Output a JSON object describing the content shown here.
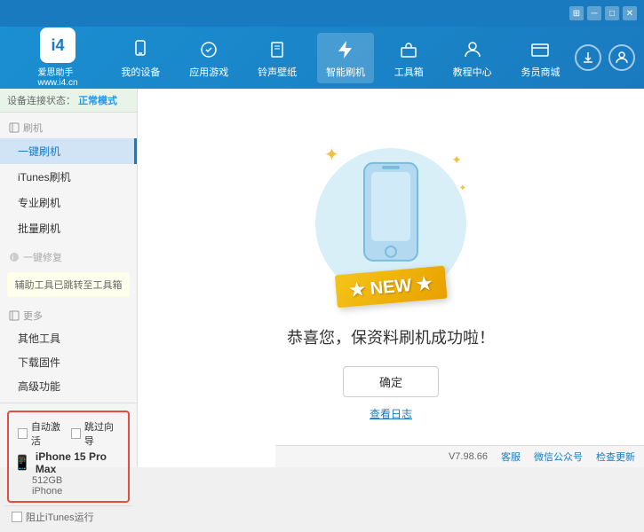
{
  "topbar": {
    "icons": [
      "grid-icon",
      "minus-icon",
      "restore-icon",
      "close-icon"
    ]
  },
  "header": {
    "logo": {
      "text": "爱思助手",
      "subtext": "www.i4.cn"
    },
    "nav": [
      {
        "id": "my-device",
        "label": "我的设备",
        "icon": "device"
      },
      {
        "id": "apps-games",
        "label": "应用游戏",
        "icon": "apps"
      },
      {
        "id": "ringtones",
        "label": "铃声壁纸",
        "icon": "ringtone"
      },
      {
        "id": "smart-flash",
        "label": "智能刷机",
        "icon": "flash",
        "active": true
      },
      {
        "id": "toolbox",
        "label": "工具箱",
        "icon": "toolbox"
      },
      {
        "id": "tutorial",
        "label": "教程中心",
        "icon": "tutorial"
      },
      {
        "id": "service",
        "label": "务员商城",
        "icon": "service"
      }
    ],
    "right": {
      "download_icon": "download",
      "user_icon": "user"
    }
  },
  "status": {
    "label": "设备连接状态：",
    "value": "正常模式"
  },
  "sidebar": {
    "flash_group": {
      "label": "刷机",
      "items": [
        {
          "id": "one-click-flash",
          "label": "一键刷机",
          "active": true
        },
        {
          "id": "itunes-flash",
          "label": "iTunes刷机"
        },
        {
          "id": "pro-flash",
          "label": "专业刷机"
        },
        {
          "id": "batch-flash",
          "label": "批量刷机"
        }
      ]
    },
    "one_click_restore": {
      "label": "一键修复",
      "disabled": true
    },
    "warning_text": "辅助工具已跳转至工具箱",
    "more_group": {
      "label": "更多",
      "items": [
        {
          "id": "other-tools",
          "label": "其他工具"
        },
        {
          "id": "download-firmware",
          "label": "下载固件"
        },
        {
          "id": "advanced",
          "label": "高级功能"
        }
      ]
    }
  },
  "bottom_controls": {
    "auto_activate": {
      "label": "自动激活",
      "checked": false
    },
    "guided_setup": {
      "label": "跳过向导",
      "checked": false
    }
  },
  "device": {
    "name": "iPhone 15 Pro Max",
    "storage": "512GB",
    "type": "iPhone"
  },
  "footer_controls": {
    "stop_itunes": "阻止iTunes运行"
  },
  "content": {
    "success_title": "恭喜您，保资料刷机成功啦！",
    "confirm_button": "确定",
    "view_log": "查看日志",
    "new_badge": "NEW"
  },
  "footer": {
    "version": "V7.98.66",
    "feedback": "客服",
    "wechat": "微信公众号",
    "check_update": "检查更新"
  }
}
